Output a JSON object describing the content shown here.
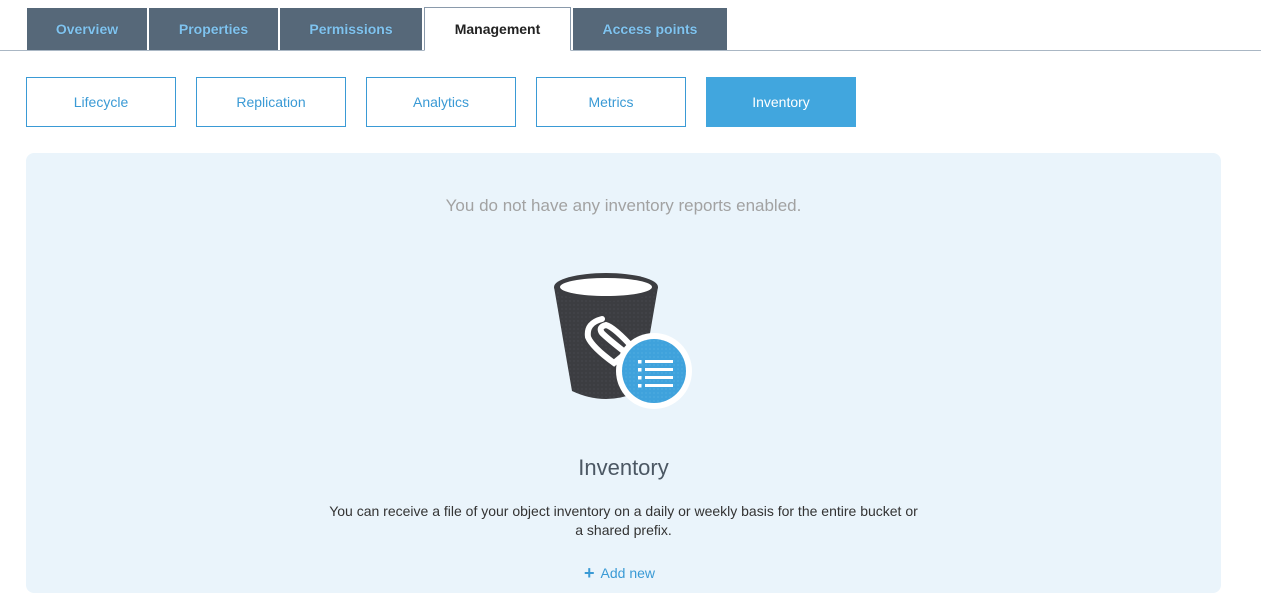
{
  "tabs": [
    {
      "label": "Overview",
      "active": false
    },
    {
      "label": "Properties",
      "active": false
    },
    {
      "label": "Permissions",
      "active": false
    },
    {
      "label": "Management",
      "active": true
    },
    {
      "label": "Access points",
      "active": false
    }
  ],
  "subtabs": [
    {
      "label": "Lifecycle",
      "active": false
    },
    {
      "label": "Replication",
      "active": false
    },
    {
      "label": "Analytics",
      "active": false
    },
    {
      "label": "Metrics",
      "active": false
    },
    {
      "label": "Inventory",
      "active": true
    }
  ],
  "empty_state": {
    "message": "You do not have any inventory reports enabled.",
    "illustration_icon": "bucket-inventory-icon",
    "title": "Inventory",
    "description": "You can receive a file of your object inventory on a daily or weekly basis for the entire bucket or a shared prefix.",
    "add_new_icon": "plus-icon",
    "add_new_label": "Add new"
  },
  "colors": {
    "tab_inactive_bg": "#566879",
    "tab_inactive_text": "#7fc3ef",
    "accent": "#41a6de",
    "panel_bg": "#eaf4fb",
    "bucket_dark": "#3c3d41"
  }
}
